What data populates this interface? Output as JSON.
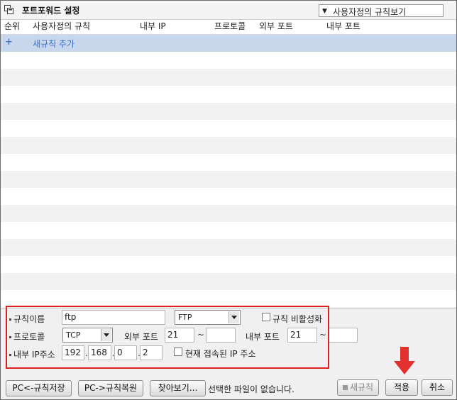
{
  "title": "포트포워드 설정",
  "view_select": {
    "value": "사용자정의 규칙보기"
  },
  "columns": [
    "순위",
    "사용자정의 규칙",
    "내부 IP",
    "프로토콜",
    "외부 포트",
    "내부 포트"
  ],
  "add_rule_label": "새규칙 추가",
  "form": {
    "rule_name_label": "규칙이름",
    "rule_name_value": "ftp",
    "preset_value": "FTP",
    "disable_label": "규칙 비활성화",
    "protocol_label": "프로토콜",
    "protocol_value": "TCP",
    "ext_port_label": "외부 포트",
    "ext_port_from": "21",
    "ext_port_to": "",
    "int_port_label": "내부 포트",
    "int_port_from": "21",
    "int_port_to": "",
    "ip_label": "내부 IP주소",
    "ip": [
      "192",
      "168",
      "0",
      "2"
    ],
    "current_ip_label": "현재 접속된 IP 주소",
    "tilde": "~",
    "dot": "."
  },
  "buttons": {
    "save_rules": "PC<-규칙저장",
    "restore_rules": "PC->규칙복원",
    "browse": "찾아보기...",
    "new_rule": "새규칙",
    "apply": "적용",
    "cancel": "취소"
  },
  "status_text": "선택한 파일이 없습니다.",
  "colors": {
    "add_row_bg": "#c8d7ec",
    "highlight_box": "#e02020",
    "arrow": "#e53030"
  }
}
